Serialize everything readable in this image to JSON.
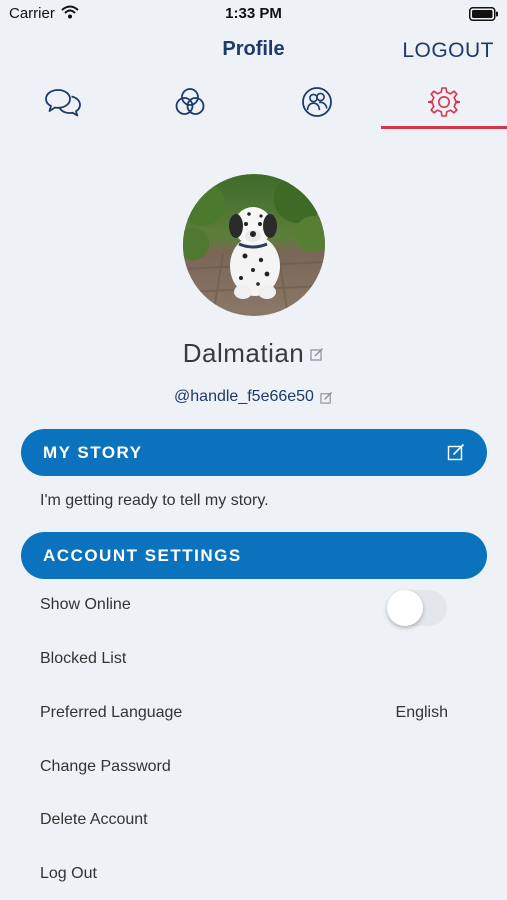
{
  "status_bar": {
    "carrier": "Carrier",
    "time": "1:33 PM"
  },
  "nav": {
    "title": "Profile",
    "logout_label": "LOGOUT"
  },
  "tabs": [
    {
      "name": "chat-icon",
      "active": false
    },
    {
      "name": "circles-icon",
      "active": false
    },
    {
      "name": "people-icon",
      "active": false
    },
    {
      "name": "gear-icon",
      "active": true
    }
  ],
  "colors": {
    "accent_blue": "#0b73bd",
    "nav_text": "#1c3a6b",
    "active_tab": "#d8344d",
    "background": "#eef1f5"
  },
  "profile": {
    "name": "Dalmatian",
    "handle": "@handle_f5e66e50",
    "avatar": "dalmatian-puppy-photo"
  },
  "story": {
    "header": "MY STORY",
    "text": "I'm getting ready to tell my story."
  },
  "account": {
    "header": "ACCOUNT SETTINGS",
    "show_online_label": "Show Online",
    "show_online_enabled": false,
    "blocked_list_label": "Blocked List",
    "language_label": "Preferred Language",
    "language_value": "English",
    "change_password_label": "Change Password",
    "delete_account_label": "Delete Account",
    "log_out_label": "Log Out"
  }
}
